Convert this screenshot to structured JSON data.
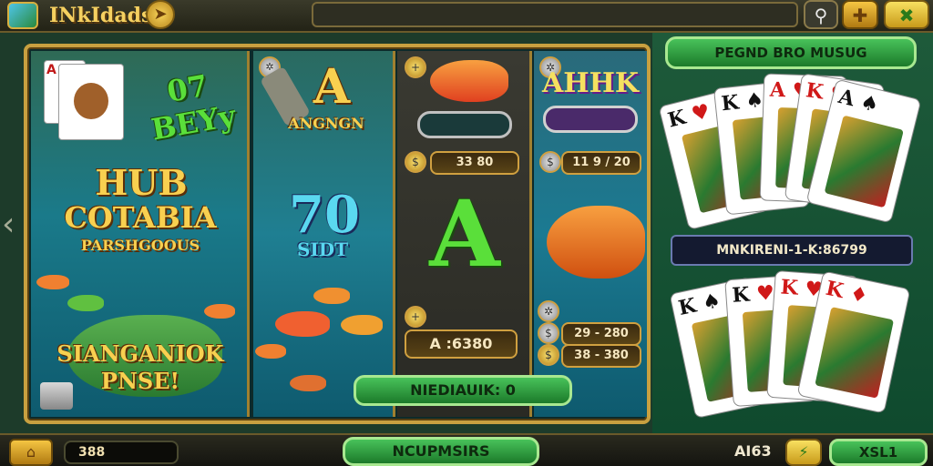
{
  "header": {
    "brand": "INkIdads",
    "badge_icon": "arrow-badge-icon",
    "search_icon": "search-icon",
    "gold_button_icon": "plus-icon",
    "green_button_icon": "close-icon"
  },
  "reels": {
    "reel1": {
      "top_text": "07 BEYy",
      "title_lines": [
        "HUB",
        "COTABIA",
        "PARSHGOOUS"
      ],
      "bottom_lines": [
        "SIANGANIOK",
        "PNSE!"
      ]
    },
    "reel2": {
      "symbol_a": "A",
      "symbol_a_sub": "ANGNGN",
      "num": "70",
      "sub": "SIDT"
    },
    "reel3": {
      "pill_value": "33 80",
      "big_symbol": "A",
      "bet_pill": "A :6380"
    },
    "reel4": {
      "title": "AHHK",
      "pill_value": "11 9 / 20",
      "row1": "29 - 280",
      "row2": "38 - 380"
    }
  },
  "center_button": "NIEDIAUIK: 0",
  "right_panel": {
    "header_button": "PEGND BRO MUSUG",
    "label": "MNKIRENI-1-K:86799",
    "top_cards": [
      "K",
      "K",
      "A",
      "K",
      "A"
    ],
    "bottom_cards": [
      "K",
      "K",
      "K",
      "K"
    ]
  },
  "footer": {
    "home_icon": "home-icon",
    "balance": "388",
    "center_button": "NCUPMSIRS",
    "bet_label": "AI63",
    "spin_label": "XSL1"
  },
  "colors": {
    "gold": "#f8d050",
    "green": "#48c25a",
    "frame": "#c8a040"
  }
}
